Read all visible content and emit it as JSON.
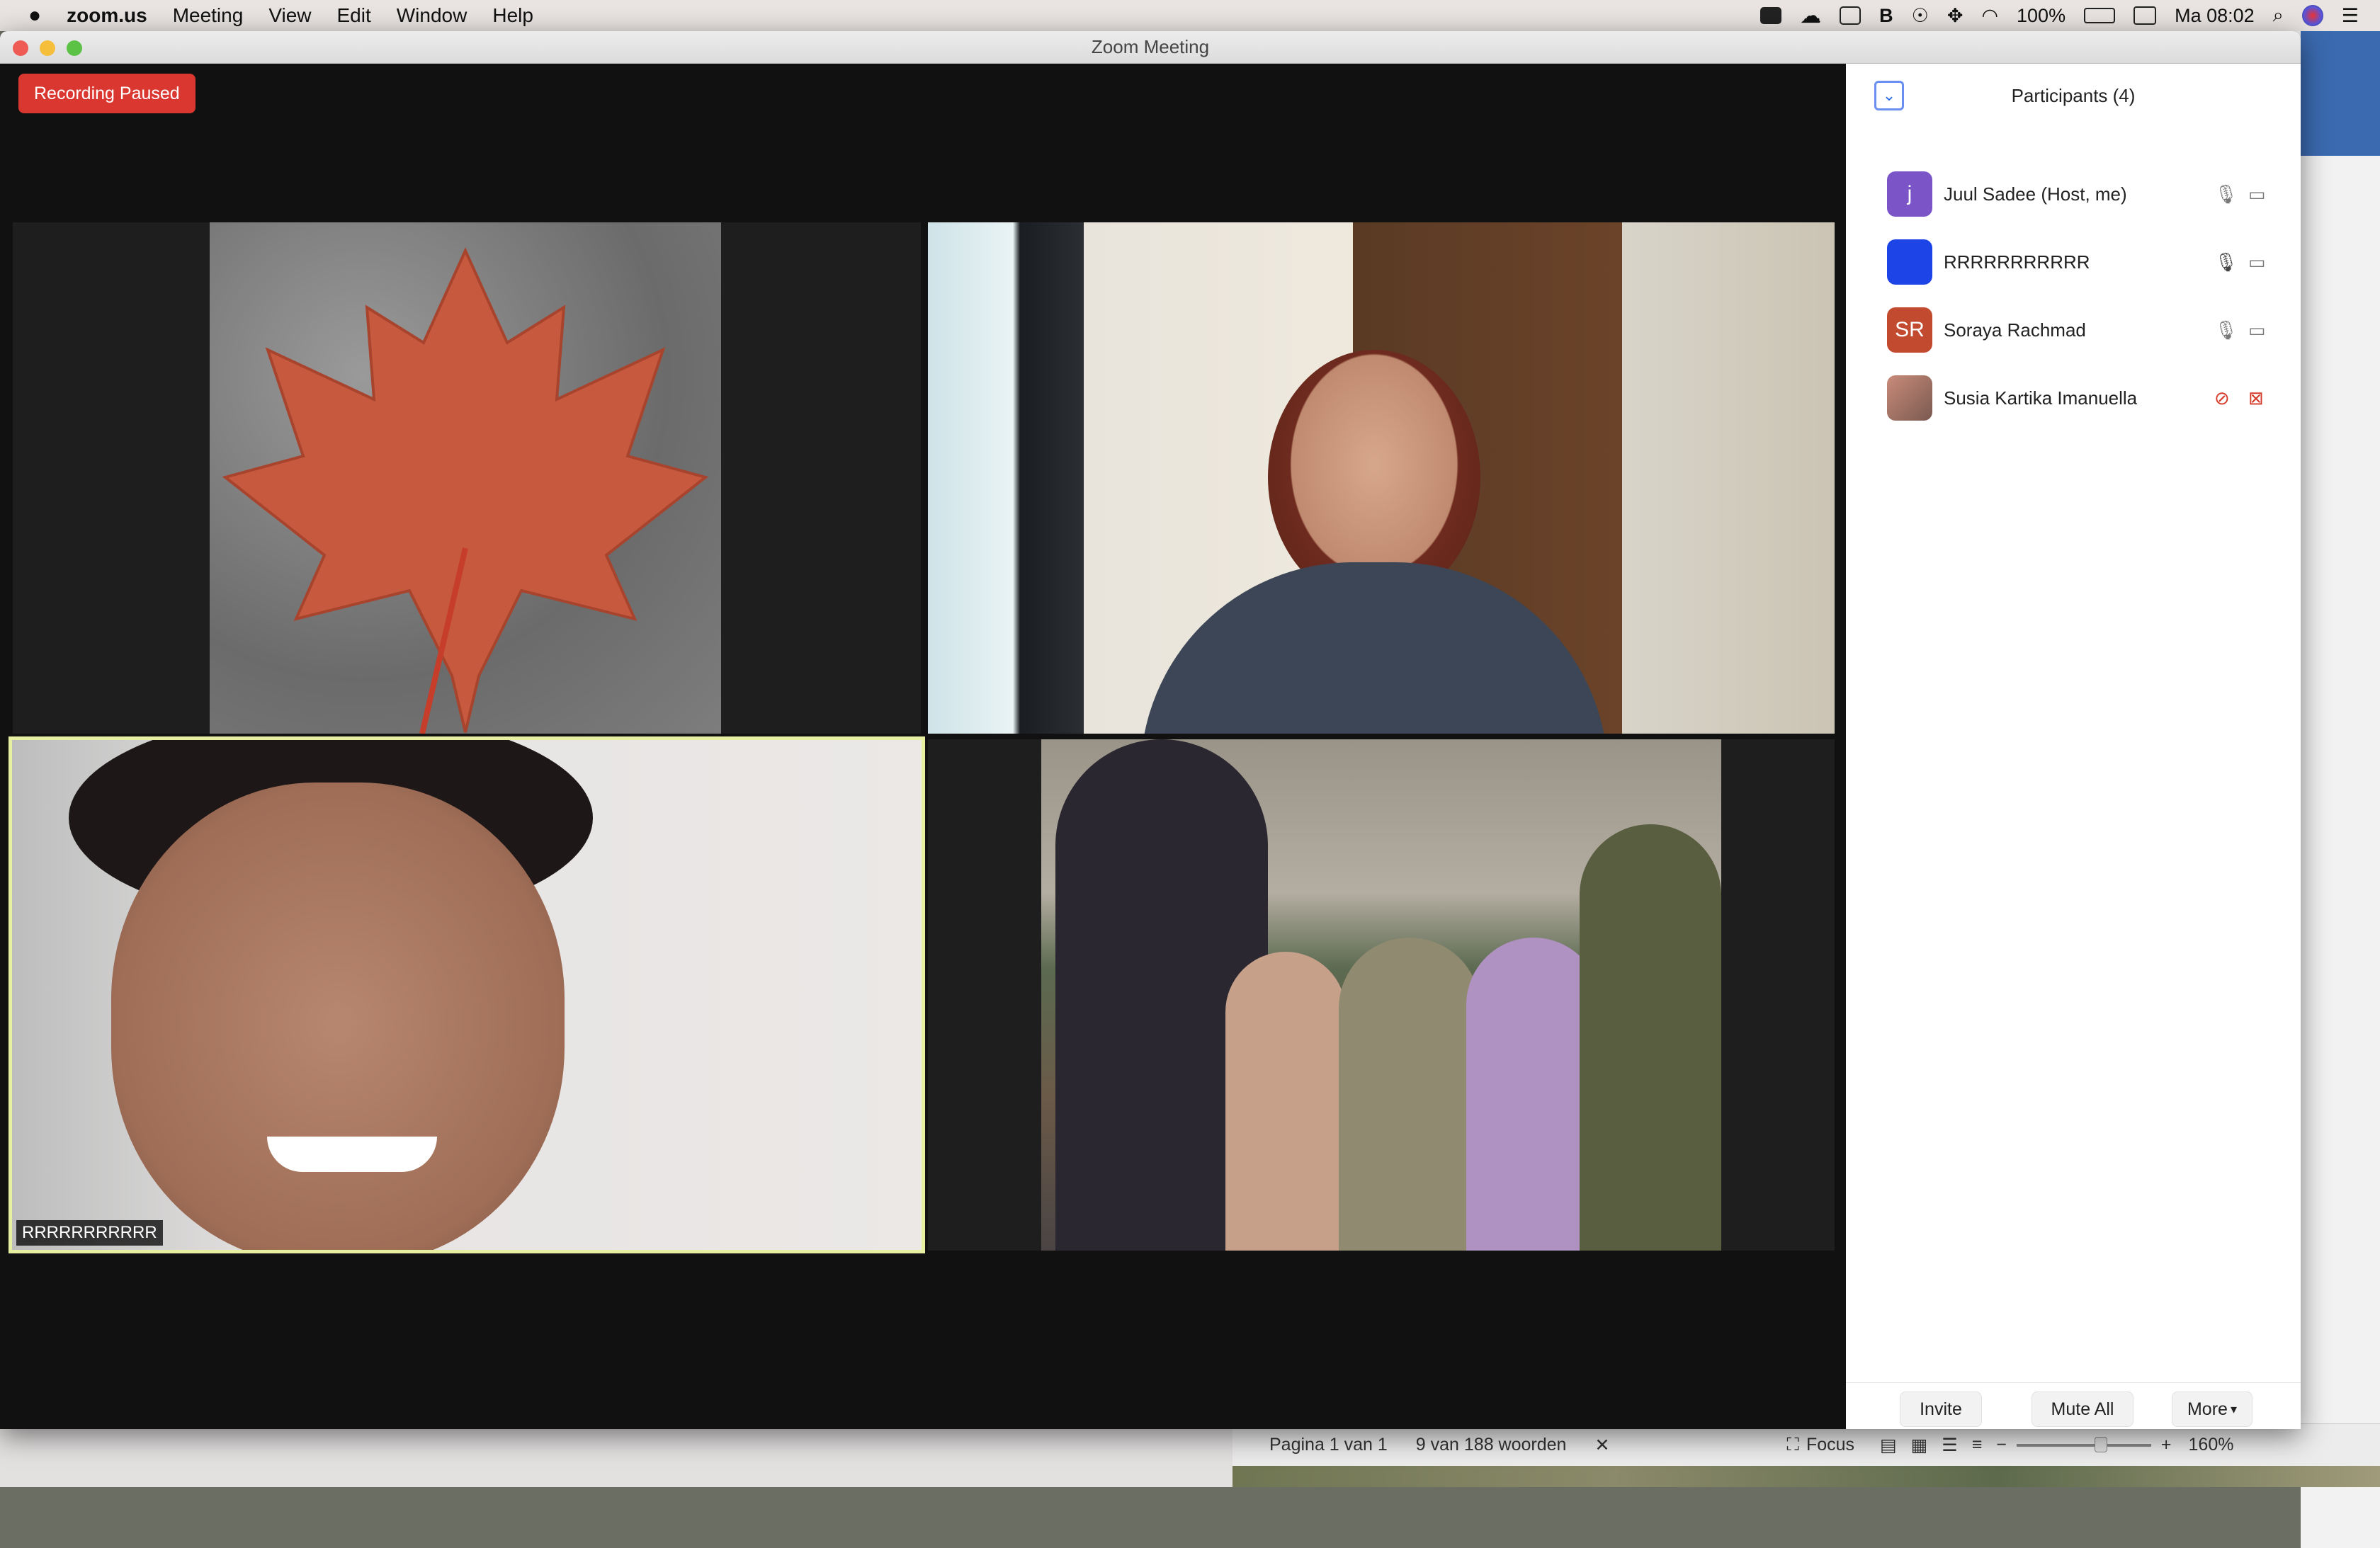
{
  "menubar": {
    "app_name": "zoom.us",
    "menus": [
      "Meeting",
      "View",
      "Edit",
      "Window",
      "Help"
    ],
    "battery": "100%",
    "clock": "Ma 08:02",
    "icons": [
      "camera-icon",
      "creative-cloud-icon",
      "display-icon",
      "bluetooth-icon",
      "accessibility-icon",
      "wifi-icon",
      "battery-icon",
      "keyboard-icon",
      "search-icon",
      "siri-icon",
      "notification-center-icon"
    ]
  },
  "window": {
    "title": "Zoom Meeting"
  },
  "recording_badge": "Recording Paused",
  "video_tiles": [
    {
      "id": "leaf",
      "name": ""
    },
    {
      "id": "woman-room",
      "name": ""
    },
    {
      "id": "man-smiling",
      "name": "RRRRRRRRRRR",
      "active_speaker": true
    },
    {
      "id": "group-women",
      "name": ""
    }
  ],
  "participants": {
    "header": "Participants (4)",
    "list": [
      {
        "name": "Juul Sadee (Host, me)",
        "initial": "j",
        "color": "#7b55c7",
        "mic": "on",
        "video": "on"
      },
      {
        "name": "RRRRRRRRRRR",
        "initial": "",
        "color": "#1c44e6",
        "mic": "on",
        "video": "on"
      },
      {
        "name": "Soraya Rachmad",
        "initial": "SR",
        "color": "#c24a2f",
        "mic": "on",
        "video": "on"
      },
      {
        "name": "Susia Kartika Imanuella",
        "initial": "",
        "color": "#9a6b5a",
        "mic": "muted",
        "video": "off"
      }
    ],
    "buttons": {
      "invite": "Invite",
      "mute_all": "Mute All",
      "more": "More"
    }
  },
  "word_status": {
    "page": "Pagina 1 van 1",
    "words": "9 van 188 woorden",
    "focus": "Focus",
    "zoom": "160%"
  },
  "colors": {
    "recording": "#d9372f",
    "active_border": "#e6f0a0",
    "muted": "#d63a2a"
  }
}
